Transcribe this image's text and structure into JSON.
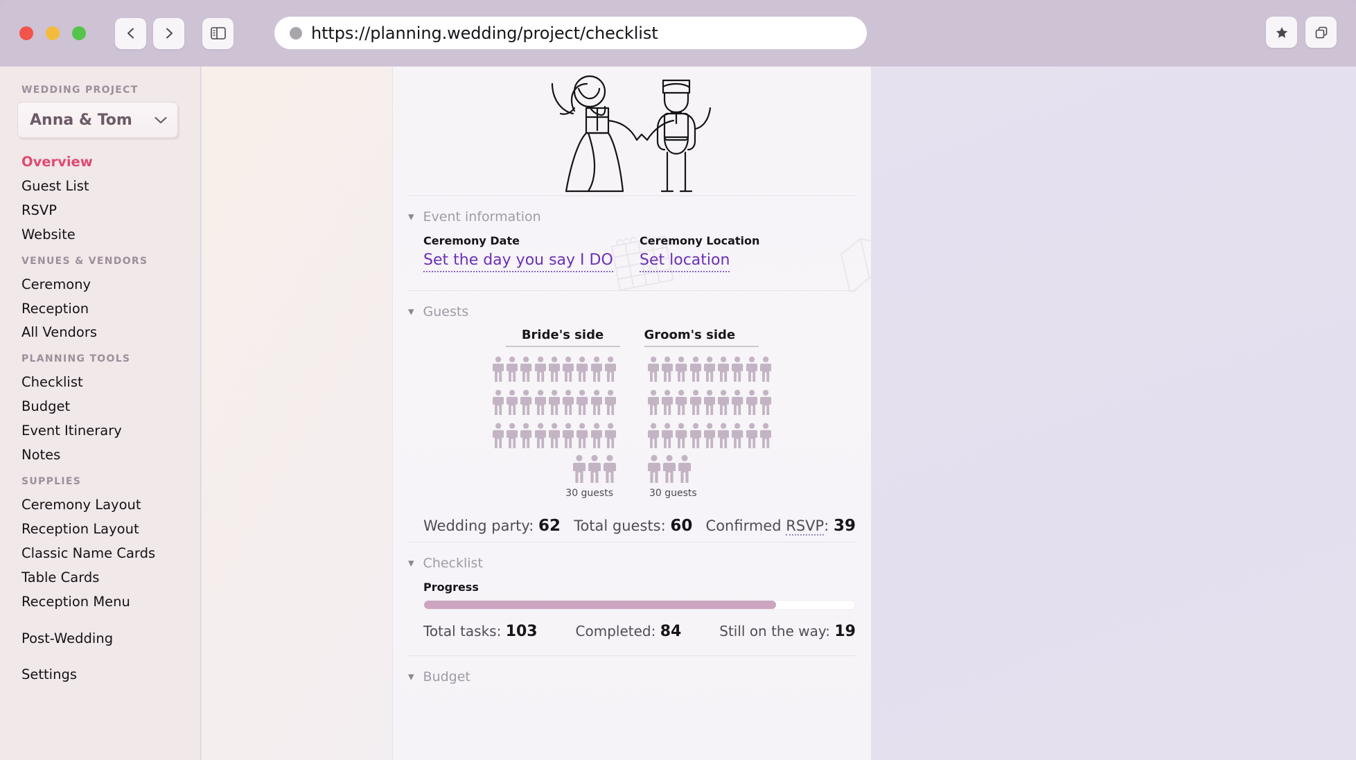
{
  "browser": {
    "url": "https://planning.wedding/project/checklist",
    "back_label": "Back",
    "forward_label": "Forward",
    "sidepanel_label": "Toggle sidebar",
    "bookmark_label": "Bookmark",
    "tabs_label": "Tab overview"
  },
  "sidebar": {
    "project_heading": "WEDDING PROJECT",
    "project_name": "Anna & Tom",
    "groups": [
      {
        "heading": "",
        "items": [
          {
            "label": "Overview",
            "active": true
          },
          {
            "label": "Guest List",
            "active": false
          },
          {
            "label": "RSVP",
            "active": false
          },
          {
            "label": "Website",
            "active": false
          }
        ]
      },
      {
        "heading": "VENUES & VENDORS",
        "items": [
          {
            "label": "Ceremony",
            "active": false
          },
          {
            "label": "Reception",
            "active": false
          },
          {
            "label": "All Vendors",
            "active": false
          }
        ]
      },
      {
        "heading": "PLANNING TOOLS",
        "items": [
          {
            "label": "Checklist",
            "active": false
          },
          {
            "label": "Budget",
            "active": false
          },
          {
            "label": "Event Itinerary",
            "active": false
          },
          {
            "label": "Notes",
            "active": false
          }
        ]
      },
      {
        "heading": "SUPPLIES",
        "items": [
          {
            "label": "Ceremony Layout",
            "active": false
          },
          {
            "label": "Reception Layout",
            "active": false
          },
          {
            "label": "Classic Name Cards",
            "active": false
          },
          {
            "label": "Table Cards",
            "active": false
          },
          {
            "label": "Reception Menu",
            "active": false
          }
        ]
      },
      {
        "heading": "",
        "items": [
          {
            "label": "Post-Wedding",
            "active": false
          }
        ]
      },
      {
        "heading": "",
        "items": [
          {
            "label": "Settings",
            "active": false
          }
        ]
      }
    ]
  },
  "main": {
    "hero_alt": "bride and groom illustration",
    "event_information": {
      "title": "Event information",
      "ceremony_date_label": "Ceremony Date",
      "ceremony_date_value": "Set the day you say I DO",
      "ceremony_location_label": "Ceremony Location",
      "ceremony_location_value": "Set location"
    },
    "guests": {
      "title": "Guests",
      "bride_head": "Bride's side",
      "groom_head": "Groom's side",
      "bride_count_label": "30 guests",
      "groom_count_label": "30 guests",
      "bride_count": 30,
      "groom_count": 30,
      "icons_per_row": 9,
      "wedding_party_label": "Wedding party:",
      "wedding_party_value": "62",
      "total_guests_label": "Total guests:",
      "total_guests_value": "60",
      "confirmed_prefix": "Confirmed",
      "confirmed_abbr": "RSVP",
      "confirmed_sep": ":",
      "confirmed_value": "39"
    },
    "checklist": {
      "title": "Checklist",
      "progress_label": "Progress",
      "progress_percent": 81.6,
      "total_tasks_label": "Total tasks:",
      "total_tasks_value": "103",
      "completed_label": "Completed:",
      "completed_value": "84",
      "remaining_label": "Still on the way:",
      "remaining_value": "19"
    },
    "budget": {
      "title": "Budget"
    }
  },
  "colors": {
    "accent_pink": "#e04a73",
    "link_purple": "#6b2fb5",
    "progress_fill": "#cba5bf",
    "person_icon": "#c3b4c4",
    "chrome": "#cec2d5",
    "sidebar_bg": "#f1e8e9"
  }
}
